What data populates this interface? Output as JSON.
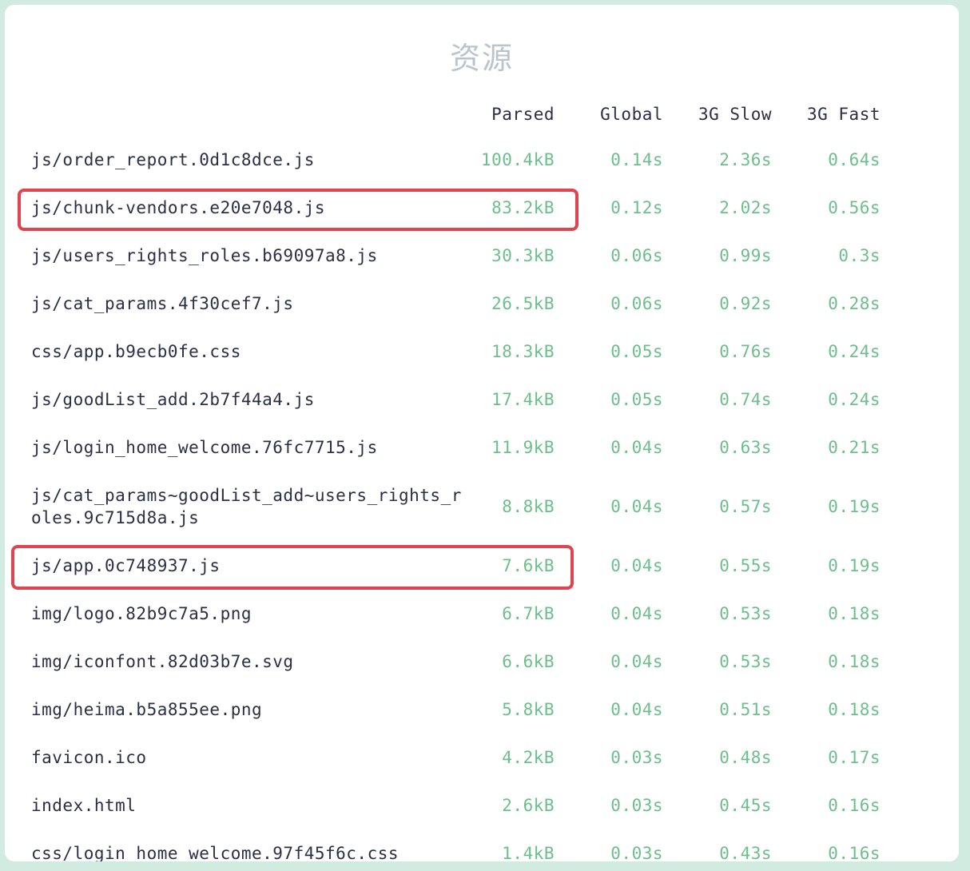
{
  "title": "资源",
  "columns": {
    "parsed": "Parsed",
    "global": "Global",
    "slow": "3G Slow",
    "fast": "3G Fast"
  },
  "rows": [
    {
      "name": "js/order_report.0d1c8dce.js",
      "parsed": "100.4kB",
      "global": "0.14s",
      "slow": "2.36s",
      "fast": "0.64s"
    },
    {
      "name": "js/chunk-vendors.e20e7048.js",
      "parsed": "83.2kB",
      "global": "0.12s",
      "slow": "2.02s",
      "fast": "0.56s",
      "highlighted": true
    },
    {
      "name": "js/users_rights_roles.b69097a8.js",
      "parsed": "30.3kB",
      "global": "0.06s",
      "slow": "0.99s",
      "fast": "0.3s"
    },
    {
      "name": "js/cat_params.4f30cef7.js",
      "parsed": "26.5kB",
      "global": "0.06s",
      "slow": "0.92s",
      "fast": "0.28s"
    },
    {
      "name": "css/app.b9ecb0fe.css",
      "parsed": "18.3kB",
      "global": "0.05s",
      "slow": "0.76s",
      "fast": "0.24s"
    },
    {
      "name": "js/goodList_add.2b7f44a4.js",
      "parsed": "17.4kB",
      "global": "0.05s",
      "slow": "0.74s",
      "fast": "0.24s"
    },
    {
      "name": "js/login_home_welcome.76fc7715.js",
      "parsed": "11.9kB",
      "global": "0.04s",
      "slow": "0.63s",
      "fast": "0.21s"
    },
    {
      "name": "js/cat_params~goodList_add~users_rights_roles.9c715d8a.js",
      "parsed": "8.8kB",
      "global": "0.04s",
      "slow": "0.57s",
      "fast": "0.19s"
    },
    {
      "name": "js/app.0c748937.js",
      "parsed": "7.6kB",
      "global": "0.04s",
      "slow": "0.55s",
      "fast": "0.19s",
      "highlighted": true
    },
    {
      "name": "img/logo.82b9c7a5.png",
      "parsed": "6.7kB",
      "global": "0.04s",
      "slow": "0.53s",
      "fast": "0.18s"
    },
    {
      "name": "img/iconfont.82d03b7e.svg",
      "parsed": "6.6kB",
      "global": "0.04s",
      "slow": "0.53s",
      "fast": "0.18s"
    },
    {
      "name": "img/heima.b5a855ee.png",
      "parsed": "5.8kB",
      "global": "0.04s",
      "slow": "0.51s",
      "fast": "0.18s"
    },
    {
      "name": "favicon.ico",
      "parsed": "4.2kB",
      "global": "0.03s",
      "slow": "0.48s",
      "fast": "0.17s"
    },
    {
      "name": "index.html",
      "parsed": "2.6kB",
      "global": "0.03s",
      "slow": "0.45s",
      "fast": "0.16s"
    },
    {
      "name": "css/login_home_welcome.97f45f6c.css",
      "parsed": "1.4kB",
      "global": "0.03s",
      "slow": "0.43s",
      "fast": "0.16s"
    }
  ],
  "colors": {
    "value": "#6cbf8b",
    "text": "#2a2f45",
    "highlight": "#e0454f",
    "background": "#d2ebe1"
  }
}
